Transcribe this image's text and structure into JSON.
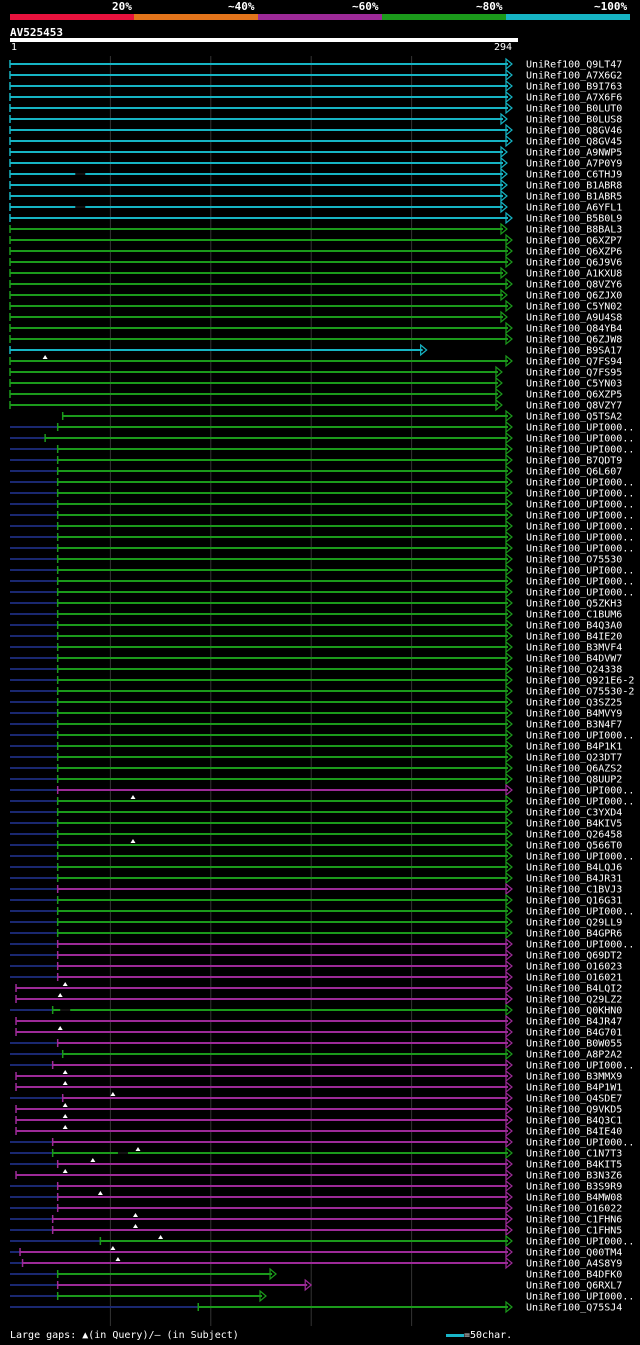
{
  "legend": {
    "labels": [
      "20%",
      "~40%",
      "~60%",
      "~80%",
      "~100%"
    ],
    "colors": [
      "#e8123d",
      "#e2741b",
      "#9d2a98",
      "#1b9a1b",
      "#16b4c4"
    ]
  },
  "query": {
    "id": "AV525453",
    "start": "1",
    "end": "294"
  },
  "footer": {
    "text": "Large gaps: ▲(in Query)/— (in Subject)",
    "scale": "=50char."
  },
  "hits": [
    {
      "label": "UniRef100_Q9LT47",
      "c": "cyan",
      "s": 0,
      "e": 1,
      "pre": 0,
      "ins": [],
      "del": []
    },
    {
      "label": "UniRef100_A7X6G2",
      "c": "cyan",
      "s": 0,
      "e": 1,
      "pre": 0,
      "ins": [],
      "del": []
    },
    {
      "label": "UniRef100_B9I763",
      "c": "cyan",
      "s": 0,
      "e": 1,
      "pre": 0,
      "ins": [],
      "del": []
    },
    {
      "label": "UniRef100_A7X6F6",
      "c": "cyan",
      "s": 0,
      "e": 1,
      "pre": 0,
      "ins": [],
      "del": []
    },
    {
      "label": "UniRef100_B0LUT0",
      "c": "cyan",
      "s": 0,
      "e": 1,
      "pre": 0,
      "ins": [],
      "del": []
    },
    {
      "label": "UniRef100_B0LUS8",
      "c": "cyan",
      "s": 0,
      "e": 0.99,
      "pre": 0,
      "ins": [],
      "del": []
    },
    {
      "label": "UniRef100_Q8GV46",
      "c": "cyan",
      "s": 0,
      "e": 1,
      "pre": 0,
      "ins": [],
      "del": []
    },
    {
      "label": "UniRef100_Q8GV45",
      "c": "cyan",
      "s": 0,
      "e": 1,
      "pre": 0,
      "ins": [],
      "del": []
    },
    {
      "label": "UniRef100_A9NWP5",
      "c": "cyan",
      "s": 0,
      "e": 0.99,
      "pre": 0,
      "ins": [],
      "del": []
    },
    {
      "label": "UniRef100_A7P0Y9",
      "c": "cyan",
      "s": 0,
      "e": 0.99,
      "pre": 0,
      "ins": [],
      "del": []
    },
    {
      "label": "UniRef100_C6THJ9",
      "c": "cyan",
      "s": 0,
      "e": 0.99,
      "pre": 0,
      "ins": [],
      "del": [
        0.14
      ]
    },
    {
      "label": "UniRef100_B1ABR8",
      "c": "cyan",
      "s": 0,
      "e": 0.99,
      "pre": 0,
      "ins": [],
      "del": []
    },
    {
      "label": "UniRef100_B1ABR5",
      "c": "cyan",
      "s": 0,
      "e": 0.99,
      "pre": 0,
      "ins": [],
      "del": []
    },
    {
      "label": "UniRef100_A6YFL1",
      "c": "cyan",
      "s": 0,
      "e": 0.99,
      "pre": 0,
      "ins": [],
      "del": [
        0.14
      ]
    },
    {
      "label": "UniRef100_B5B0L9",
      "c": "cyan",
      "s": 0,
      "e": 1,
      "pre": 0,
      "ins": [],
      "del": []
    },
    {
      "label": "UniRef100_B8BAL3",
      "c": "green",
      "s": 0,
      "e": 0.99,
      "pre": 0,
      "ins": [],
      "del": []
    },
    {
      "label": "UniRef100_Q6XZP7",
      "c": "green",
      "s": 0,
      "e": 1,
      "pre": 0,
      "ins": [],
      "del": []
    },
    {
      "label": "UniRef100_Q6XZP6",
      "c": "green",
      "s": 0,
      "e": 1,
      "pre": 0,
      "ins": [],
      "del": []
    },
    {
      "label": "UniRef100_Q6J9V6",
      "c": "green",
      "s": 0,
      "e": 1,
      "pre": 0,
      "ins": [],
      "del": []
    },
    {
      "label": "UniRef100_A1KXU8",
      "c": "green",
      "s": 0,
      "e": 0.99,
      "pre": 0,
      "ins": [],
      "del": []
    },
    {
      "label": "UniRef100_Q8VZY6",
      "c": "green",
      "s": 0,
      "e": 1,
      "pre": 0,
      "ins": [],
      "del": []
    },
    {
      "label": "UniRef100_Q6ZJX0",
      "c": "green",
      "s": 0,
      "e": 0.99,
      "pre": 0,
      "ins": [],
      "del": []
    },
    {
      "label": "UniRef100_C5YN02",
      "c": "green",
      "s": 0,
      "e": 1,
      "pre": 0,
      "ins": [],
      "del": []
    },
    {
      "label": "UniRef100_A9U4S8",
      "c": "green",
      "s": 0,
      "e": 0.99,
      "pre": 0,
      "ins": [],
      "del": []
    },
    {
      "label": "UniRef100_Q84YB4",
      "c": "green",
      "s": 0,
      "e": 1,
      "pre": 0,
      "ins": [],
      "del": []
    },
    {
      "label": "UniRef100_Q6ZJW8",
      "c": "green",
      "s": 0,
      "e": 1,
      "pre": 0,
      "ins": [],
      "del": []
    },
    {
      "label": "UniRef100_B9SA17",
      "c": "cyan",
      "s": 0,
      "e": 0.83,
      "pre": 0,
      "ins": [],
      "del": []
    },
    {
      "label": "UniRef100_Q7FS94",
      "c": "green",
      "s": 0,
      "e": 1,
      "pre": 0,
      "ins": [
        0.07
      ],
      "del": []
    },
    {
      "label": "UniRef100_Q7FS95",
      "c": "green",
      "s": 0,
      "e": 0.98,
      "pre": 0,
      "ins": [],
      "del": []
    },
    {
      "label": "UniRef100_C5YN03",
      "c": "green",
      "s": 0,
      "e": 0.98,
      "pre": 0,
      "ins": [],
      "del": []
    },
    {
      "label": "UniRef100_Q6XZP5",
      "c": "green",
      "s": 0,
      "e": 0.98,
      "pre": 0,
      "ins": [],
      "del": []
    },
    {
      "label": "UniRef100_Q8VZY7",
      "c": "green",
      "s": 0,
      "e": 0.98,
      "pre": 0,
      "ins": [],
      "del": []
    },
    {
      "label": "UniRef100_Q5TSA2",
      "c": "green",
      "s": 0.105,
      "e": 1,
      "pre": 0,
      "ins": [],
      "del": []
    },
    {
      "label": "UniRef100_UPI000..",
      "c": "green",
      "s": 0.095,
      "e": 1,
      "pre": 0.095,
      "ins": [],
      "del": []
    },
    {
      "label": "UniRef100_UPI000..",
      "c": "green",
      "s": 0.07,
      "e": 1,
      "pre": 0.07,
      "ins": [],
      "del": []
    },
    {
      "label": "UniRef100_UPI000..",
      "c": "green",
      "s": 0.095,
      "e": 1,
      "pre": 0.095,
      "ins": [],
      "del": []
    },
    {
      "label": "UniRef100_B7QDT9",
      "c": "green",
      "s": 0.095,
      "e": 1,
      "pre": 0.095,
      "ins": [],
      "del": []
    },
    {
      "label": "UniRef100_Q6L607",
      "c": "green",
      "s": 0.095,
      "e": 1,
      "pre": 0.095,
      "ins": [],
      "del": []
    },
    {
      "label": "UniRef100_UPI000..",
      "c": "green",
      "s": 0.095,
      "e": 1,
      "pre": 0.095,
      "ins": [],
      "del": []
    },
    {
      "label": "UniRef100_UPI000..",
      "c": "green",
      "s": 0.095,
      "e": 1,
      "pre": 0.095,
      "ins": [],
      "del": []
    },
    {
      "label": "UniRef100_UPI000..",
      "c": "green",
      "s": 0.095,
      "e": 1,
      "pre": 0.095,
      "ins": [],
      "del": []
    },
    {
      "label": "UniRef100_UPI000..",
      "c": "green",
      "s": 0.095,
      "e": 1,
      "pre": 0.095,
      "ins": [],
      "del": []
    },
    {
      "label": "UniRef100_UPI000..",
      "c": "green",
      "s": 0.095,
      "e": 1,
      "pre": 0.095,
      "ins": [],
      "del": []
    },
    {
      "label": "UniRef100_UPI000..",
      "c": "green",
      "s": 0.095,
      "e": 1,
      "pre": 0.095,
      "ins": [],
      "del": []
    },
    {
      "label": "UniRef100_UPI000..",
      "c": "green",
      "s": 0.095,
      "e": 1,
      "pre": 0.095,
      "ins": [],
      "del": []
    },
    {
      "label": "UniRef100_O75530",
      "c": "green",
      "s": 0.095,
      "e": 1,
      "pre": 0.095,
      "ins": [],
      "del": []
    },
    {
      "label": "UniRef100_UPI000..",
      "c": "green",
      "s": 0.095,
      "e": 1,
      "pre": 0.095,
      "ins": [],
      "del": []
    },
    {
      "label": "UniRef100_UPI000..",
      "c": "green",
      "s": 0.095,
      "e": 1,
      "pre": 0.095,
      "ins": [],
      "del": []
    },
    {
      "label": "UniRef100_UPI000..",
      "c": "green",
      "s": 0.095,
      "e": 1,
      "pre": 0.095,
      "ins": [],
      "del": []
    },
    {
      "label": "UniRef100_Q5ZKH3",
      "c": "green",
      "s": 0.095,
      "e": 1,
      "pre": 0.095,
      "ins": [],
      "del": []
    },
    {
      "label": "UniRef100_C1BUM6",
      "c": "green",
      "s": 0.095,
      "e": 1,
      "pre": 0.095,
      "ins": [],
      "del": []
    },
    {
      "label": "UniRef100_B4Q3A0",
      "c": "green",
      "s": 0.095,
      "e": 1,
      "pre": 0.095,
      "ins": [],
      "del": []
    },
    {
      "label": "UniRef100_B4IE20",
      "c": "green",
      "s": 0.095,
      "e": 1,
      "pre": 0.095,
      "ins": [],
      "del": []
    },
    {
      "label": "UniRef100_B3MVF4",
      "c": "green",
      "s": 0.095,
      "e": 1,
      "pre": 0.095,
      "ins": [],
      "del": []
    },
    {
      "label": "UniRef100_B4DVW7",
      "c": "green",
      "s": 0.095,
      "e": 1,
      "pre": 0.095,
      "ins": [],
      "del": []
    },
    {
      "label": "UniRef100_Q24338",
      "c": "green",
      "s": 0.095,
      "e": 1,
      "pre": 0.095,
      "ins": [],
      "del": []
    },
    {
      "label": "UniRef100_Q921E6-2",
      "c": "green",
      "s": 0.095,
      "e": 1,
      "pre": 0.095,
      "ins": [],
      "del": []
    },
    {
      "label": "UniRef100_O75530-2",
      "c": "green",
      "s": 0.095,
      "e": 1,
      "pre": 0.095,
      "ins": [],
      "del": []
    },
    {
      "label": "UniRef100_Q3SZ25",
      "c": "green",
      "s": 0.095,
      "e": 1,
      "pre": 0.095,
      "ins": [],
      "del": []
    },
    {
      "label": "UniRef100_B4MVY9",
      "c": "green",
      "s": 0.095,
      "e": 1,
      "pre": 0.095,
      "ins": [],
      "del": []
    },
    {
      "label": "UniRef100_B3N4F7",
      "c": "green",
      "s": 0.095,
      "e": 1,
      "pre": 0.095,
      "ins": [],
      "del": []
    },
    {
      "label": "UniRef100_UPI000..",
      "c": "green",
      "s": 0.095,
      "e": 1,
      "pre": 0.095,
      "ins": [],
      "del": []
    },
    {
      "label": "UniRef100_B4P1K1",
      "c": "green",
      "s": 0.095,
      "e": 1,
      "pre": 0.095,
      "ins": [],
      "del": []
    },
    {
      "label": "UniRef100_Q23DT7",
      "c": "green",
      "s": 0.095,
      "e": 1,
      "pre": 0.095,
      "ins": [],
      "del": []
    },
    {
      "label": "UniRef100_Q6AZS2",
      "c": "green",
      "s": 0.095,
      "e": 1,
      "pre": 0.095,
      "ins": [],
      "del": []
    },
    {
      "label": "UniRef100_Q8UUP2",
      "c": "green",
      "s": 0.095,
      "e": 1,
      "pre": 0.095,
      "ins": [],
      "del": []
    },
    {
      "label": "UniRef100_UPI000..",
      "c": "magenta",
      "s": 0.095,
      "e": 1,
      "pre": 0.095,
      "ins": [],
      "del": []
    },
    {
      "label": "UniRef100_UPI000..",
      "c": "green",
      "s": 0.095,
      "e": 1,
      "pre": 0.095,
      "ins": [
        0.245
      ],
      "del": []
    },
    {
      "label": "UniRef100_C3YXD4",
      "c": "green",
      "s": 0.095,
      "e": 1,
      "pre": 0.095,
      "ins": [],
      "del": []
    },
    {
      "label": "UniRef100_B4KIV5",
      "c": "green",
      "s": 0.095,
      "e": 1,
      "pre": 0.095,
      "ins": [],
      "del": []
    },
    {
      "label": "UniRef100_Q26458",
      "c": "green",
      "s": 0.095,
      "e": 1,
      "pre": 0.095,
      "ins": [],
      "del": []
    },
    {
      "label": "UniRef100_Q566T0",
      "c": "green",
      "s": 0.095,
      "e": 1,
      "pre": 0.095,
      "ins": [
        0.245
      ],
      "del": []
    },
    {
      "label": "UniRef100_UPI000..",
      "c": "green",
      "s": 0.095,
      "e": 1,
      "pre": 0.095,
      "ins": [],
      "del": []
    },
    {
      "label": "UniRef100_B4LQJ6",
      "c": "green",
      "s": 0.095,
      "e": 1,
      "pre": 0.095,
      "ins": [],
      "del": []
    },
    {
      "label": "UniRef100_B4JR31",
      "c": "green",
      "s": 0.095,
      "e": 1,
      "pre": 0.095,
      "ins": [],
      "del": []
    },
    {
      "label": "UniRef100_C1BVJ3",
      "c": "magenta",
      "s": 0.095,
      "e": 1,
      "pre": 0.095,
      "ins": [],
      "del": []
    },
    {
      "label": "UniRef100_Q16G31",
      "c": "green",
      "s": 0.095,
      "e": 1,
      "pre": 0.095,
      "ins": [],
      "del": []
    },
    {
      "label": "UniRef100_UPI000..",
      "c": "green",
      "s": 0.095,
      "e": 1,
      "pre": 0.095,
      "ins": [],
      "del": []
    },
    {
      "label": "UniRef100_Q29LL9",
      "c": "green",
      "s": 0.095,
      "e": 1,
      "pre": 0.095,
      "ins": [],
      "del": []
    },
    {
      "label": "UniRef100_B4GPR6",
      "c": "green",
      "s": 0.095,
      "e": 1,
      "pre": 0.095,
      "ins": [],
      "del": []
    },
    {
      "label": "UniRef100_UPI000..",
      "c": "magenta",
      "s": 0.095,
      "e": 1,
      "pre": 0.095,
      "ins": [],
      "del": []
    },
    {
      "label": "UniRef100_Q69DT2",
      "c": "magenta",
      "s": 0.095,
      "e": 1,
      "pre": 0.095,
      "ins": [],
      "del": []
    },
    {
      "label": "UniRef100_O16023",
      "c": "magenta",
      "s": 0.095,
      "e": 1,
      "pre": 0.095,
      "ins": [],
      "del": []
    },
    {
      "label": "UniRef100_O16021",
      "c": "magenta",
      "s": 0.095,
      "e": 1,
      "pre": 0.095,
      "ins": [],
      "del": []
    },
    {
      "label": "UniRef100_B4LQI2",
      "c": "magenta",
      "s": 0.012,
      "e": 1,
      "pre": 0,
      "ins": [
        0.11
      ],
      "del": []
    },
    {
      "label": "UniRef100_Q29LZ2",
      "c": "magenta",
      "s": 0.012,
      "e": 1,
      "pre": 0,
      "ins": [
        0.1
      ],
      "del": []
    },
    {
      "label": "UniRef100_Q0KHN0",
      "c": "green",
      "s": 0.085,
      "e": 1,
      "pre": 0.085,
      "ins": [],
      "del": [
        0.11
      ]
    },
    {
      "label": "UniRef100_B4JR47",
      "c": "magenta",
      "s": 0.012,
      "e": 1,
      "pre": 0,
      "ins": [],
      "del": []
    },
    {
      "label": "UniRef100_B4G701",
      "c": "magenta",
      "s": 0.012,
      "e": 1,
      "pre": 0,
      "ins": [
        0.1
      ],
      "del": []
    },
    {
      "label": "UniRef100_B0W055",
      "c": "magenta",
      "s": 0.095,
      "e": 1,
      "pre": 0.095,
      "ins": [],
      "del": []
    },
    {
      "label": "UniRef100_A8P2A2",
      "c": "green",
      "s": 0.105,
      "e": 1,
      "pre": 0.105,
      "ins": [],
      "del": []
    },
    {
      "label": "UniRef100_UPI000..",
      "c": "magenta",
      "s": 0.085,
      "e": 1,
      "pre": 0.085,
      "ins": [],
      "del": []
    },
    {
      "label": "UniRef100_B3MMX9",
      "c": "magenta",
      "s": 0.012,
      "e": 1,
      "pre": 0,
      "ins": [
        0.11
      ],
      "del": []
    },
    {
      "label": "UniRef100_B4P1W1",
      "c": "magenta",
      "s": 0.012,
      "e": 1,
      "pre": 0,
      "ins": [
        0.11
      ],
      "del": []
    },
    {
      "label": "UniRef100_Q4SDE7",
      "c": "magenta",
      "s": 0.105,
      "e": 1,
      "pre": 0.105,
      "ins": [
        0.205
      ],
      "del": []
    },
    {
      "label": "UniRef100_Q9VKD5",
      "c": "magenta",
      "s": 0.012,
      "e": 1,
      "pre": 0,
      "ins": [
        0.11
      ],
      "del": []
    },
    {
      "label": "UniRef100_B4Q3C1",
      "c": "magenta",
      "s": 0.012,
      "e": 1,
      "pre": 0,
      "ins": [
        0.11
      ],
      "del": []
    },
    {
      "label": "UniRef100_B4IE40",
      "c": "magenta",
      "s": 0.012,
      "e": 1,
      "pre": 0,
      "ins": [
        0.11
      ],
      "del": []
    },
    {
      "label": "UniRef100_UPI000..",
      "c": "magenta",
      "s": 0.085,
      "e": 1,
      "pre": 0.085,
      "ins": [],
      "del": []
    },
    {
      "label": "UniRef100_C1N7T3",
      "c": "green",
      "s": 0.085,
      "e": 1,
      "pre": 0.085,
      "ins": [
        0.255
      ],
      "del": [
        0.225
      ]
    },
    {
      "label": "UniRef100_B4KIT5",
      "c": "magenta",
      "s": 0.095,
      "e": 1,
      "pre": 0.095,
      "ins": [
        0.165
      ],
      "del": []
    },
    {
      "label": "UniRef100_B3N3Z6",
      "c": "magenta",
      "s": 0.012,
      "e": 1,
      "pre": 0,
      "ins": [
        0.11
      ],
      "del": []
    },
    {
      "label": "UniRef100_B3S9R9",
      "c": "magenta",
      "s": 0.095,
      "e": 1,
      "pre": 0.095,
      "ins": [],
      "del": []
    },
    {
      "label": "UniRef100_B4MW08",
      "c": "magenta",
      "s": 0.095,
      "e": 1,
      "pre": 0.095,
      "ins": [
        0.18
      ],
      "del": []
    },
    {
      "label": "UniRef100_O16022",
      "c": "magenta",
      "s": 0.095,
      "e": 1,
      "pre": 0.095,
      "ins": [],
      "del": []
    },
    {
      "label": "UniRef100_C1FHN6",
      "c": "magenta",
      "s": 0.085,
      "e": 1,
      "pre": 0.085,
      "ins": [
        0.25
      ],
      "del": []
    },
    {
      "label": "UniRef100_C1FHN5",
      "c": "magenta",
      "s": 0.085,
      "e": 1,
      "pre": 0.085,
      "ins": [
        0.25
      ],
      "del": []
    },
    {
      "label": "UniRef100_UPI000..",
      "c": "green",
      "s": 0.18,
      "e": 1,
      "pre": 0.18,
      "ins": [
        0.3
      ],
      "del": []
    },
    {
      "label": "UniRef100_Q00TM4",
      "c": "magenta",
      "s": 0.02,
      "e": 1,
      "pre": 0.02,
      "ins": [
        0.205
      ],
      "del": []
    },
    {
      "label": "UniRef100_A4S8Y9",
      "c": "magenta",
      "s": 0.025,
      "e": 1,
      "pre": 0.025,
      "ins": [
        0.215
      ],
      "del": []
    },
    {
      "label": "UniRef100_B4DFK0",
      "c": "green",
      "s": 0.095,
      "e": 0.53,
      "pre": 0.095,
      "ins": [],
      "del": []
    },
    {
      "label": "UniRef100_Q6RXL7",
      "c": "magenta",
      "s": 0.095,
      "e": 0.6,
      "pre": 0.095,
      "ins": [],
      "del": []
    },
    {
      "label": "UniRef100_UPI000..",
      "c": "green",
      "s": 0.095,
      "e": 0.51,
      "pre": 0.095,
      "ins": [],
      "del": []
    },
    {
      "label": "UniRef100_Q75SJ4",
      "c": "green",
      "s": 0.375,
      "e": 1,
      "pre": 0.375,
      "ins": [],
      "del": []
    }
  ]
}
